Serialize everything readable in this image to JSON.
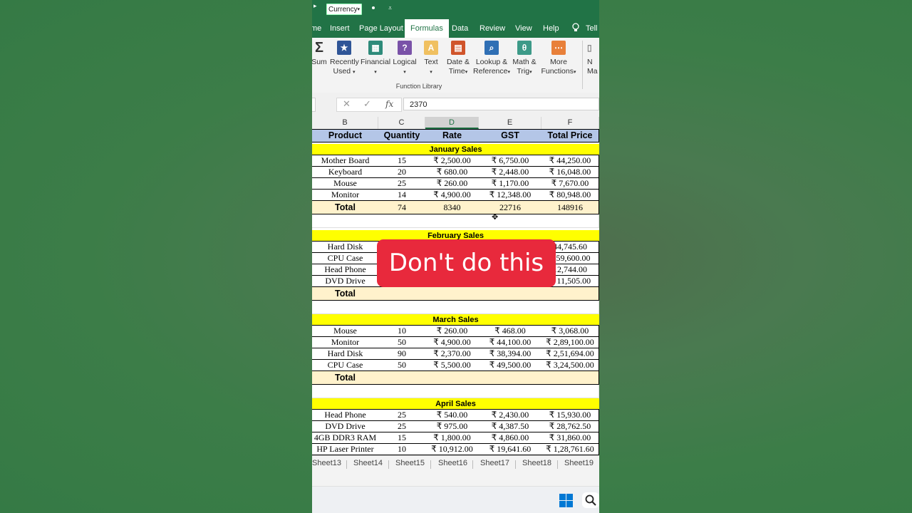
{
  "quick_access": {
    "number_format": "Currency"
  },
  "tabs": [
    "me",
    "Insert",
    "Page Layout",
    "Formulas",
    "Data",
    "Review",
    "View",
    "Help",
    "Tell"
  ],
  "active_tab": "Formulas",
  "ribbon": {
    "buttons": [
      {
        "line1": "Sum",
        "line2": "",
        "icon": "autosum-icon"
      },
      {
        "line1": "Recently",
        "line2": "Used",
        "icon": "star-book-icon",
        "color": "#2f5597"
      },
      {
        "line1": "Financial",
        "line2": "",
        "icon": "financial-book-icon",
        "color": "#2e8b7a"
      },
      {
        "line1": "Logical",
        "line2": "",
        "icon": "question-book-icon",
        "color": "#7a52a8"
      },
      {
        "line1": "Text",
        "line2": "",
        "icon": "text-book-icon",
        "color": "#e8b44a"
      },
      {
        "line1": "Date &",
        "line2": "Time",
        "icon": "calendar-book-icon",
        "color": "#d0542a"
      },
      {
        "line1": "Lookup &",
        "line2": "Reference",
        "icon": "lookup-book-icon",
        "color": "#2f6fb4"
      },
      {
        "line1": "Math &",
        "line2": "Trig",
        "icon": "theta-book-icon",
        "color": "#3d9a88"
      },
      {
        "line1": "More",
        "line2": "Functions",
        "icon": "more-book-icon",
        "color": "#e8803a"
      },
      {
        "line1": "N",
        "line2": "Ma",
        "icon": "name-manager-icon"
      }
    ],
    "group_label": "Function Library"
  },
  "formula_bar": {
    "value": "2370"
  },
  "columns": [
    "B",
    "C",
    "D",
    "E",
    "F"
  ],
  "selected_column": "D",
  "table_header": [
    "Product",
    "Quantity",
    "Rate",
    "GST",
    "Total Price"
  ],
  "sections": [
    {
      "title": "January Sales",
      "rows": [
        [
          "Mother Board",
          "15",
          "₹ 2,500.00",
          "₹ 6,750.00",
          "₹ 44,250.00"
        ],
        [
          "Keyboard",
          "20",
          "₹ 680.00",
          "₹ 2,448.00",
          "₹ 16,048.00"
        ],
        [
          "Mouse",
          "25",
          "₹ 260.00",
          "₹ 1,170.00",
          "₹ 7,670.00"
        ],
        [
          "Monitor",
          "14",
          "₹ 4,900.00",
          "₹ 12,348.00",
          "₹ 80,948.00"
        ]
      ],
      "total": [
        "Total",
        "74",
        "8340",
        "22716",
        "148916"
      ]
    },
    {
      "title": "February Sales",
      "rows": [
        [
          "Hard Disk",
          "",
          "",
          "",
          "44,745.60"
        ],
        [
          "CPU Case",
          "",
          "",
          "",
          "2,59,600.00"
        ],
        [
          "Head Phone",
          "",
          "",
          "",
          "12,744.00"
        ],
        [
          "DVD Drive",
          "",
          "",
          "",
          "₹ 11,505.00"
        ]
      ],
      "total": [
        "Total",
        "",
        "",
        "",
        ""
      ]
    },
    {
      "title": "March Sales",
      "rows": [
        [
          "Mouse",
          "10",
          "₹ 260.00",
          "₹ 468.00",
          "₹ 3,068.00"
        ],
        [
          "Monitor",
          "50",
          "₹ 4,900.00",
          "₹ 44,100.00",
          "₹ 2,89,100.00"
        ],
        [
          "Hard Disk",
          "90",
          "₹ 2,370.00",
          "₹ 38,394.00",
          "₹ 2,51,694.00"
        ],
        [
          "CPU Case",
          "50",
          "₹ 5,500.00",
          "₹ 49,500.00",
          "₹ 3,24,500.00"
        ]
      ],
      "total": [
        "Total",
        "",
        "",
        "",
        ""
      ]
    },
    {
      "title": "April Sales",
      "rows": [
        [
          "Head Phone",
          "25",
          "₹ 540.00",
          "₹ 2,430.00",
          "₹ 15,930.00"
        ],
        [
          "DVD Drive",
          "25",
          "₹ 975.00",
          "₹ 4,387.50",
          "₹ 28,762.50"
        ],
        [
          "4GB DDR3 RAM",
          "15",
          "₹ 1,800.00",
          "₹ 4,860.00",
          "₹ 31,860.00"
        ],
        [
          "HP Laser Printer",
          "10",
          "₹ 10,912.00",
          "₹ 19,641.60",
          "₹ 1,28,761.60"
        ]
      ],
      "total": null
    }
  ],
  "sheet_tabs": [
    "Sheet13",
    "Sheet14",
    "Sheet15",
    "Sheet16",
    "Sheet17",
    "Sheet18",
    "Sheet19"
  ],
  "overlay": {
    "text": "Don't do this",
    "color": "#e8293c"
  },
  "colors": {
    "excel_green": "#217346",
    "header_blue": "#b4c6e7",
    "section_yellow": "#ffff00",
    "total_fill": "#fff2cc"
  }
}
